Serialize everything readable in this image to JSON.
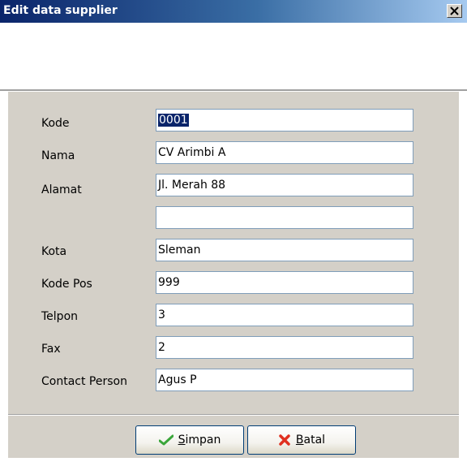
{
  "window": {
    "title": "Edit data supplier",
    "close_icon": "close-x-icon"
  },
  "form": {
    "fields": [
      {
        "label": "Kode",
        "value": "0001",
        "selected": true
      },
      {
        "label": "Nama",
        "value": "CV Arimbi A"
      },
      {
        "label": "Alamat",
        "value": "Jl. Merah 88"
      },
      {
        "label": "",
        "value": ""
      },
      {
        "label": "Kota",
        "value": "Sleman"
      },
      {
        "label": "Kode Pos",
        "value": "999"
      },
      {
        "label": "Telpon",
        "value": "3"
      },
      {
        "label": "Fax",
        "value": "2"
      },
      {
        "label": "Contact Person",
        "value": "Agus P"
      }
    ]
  },
  "buttons": {
    "save": {
      "accel": "S",
      "rest": "impan",
      "icon": "checkmark-icon",
      "icon_color": "#3aa63a"
    },
    "cancel": {
      "accel": "B",
      "rest": "atal",
      "icon": "red-x-icon",
      "icon_color": "#e03020"
    }
  }
}
